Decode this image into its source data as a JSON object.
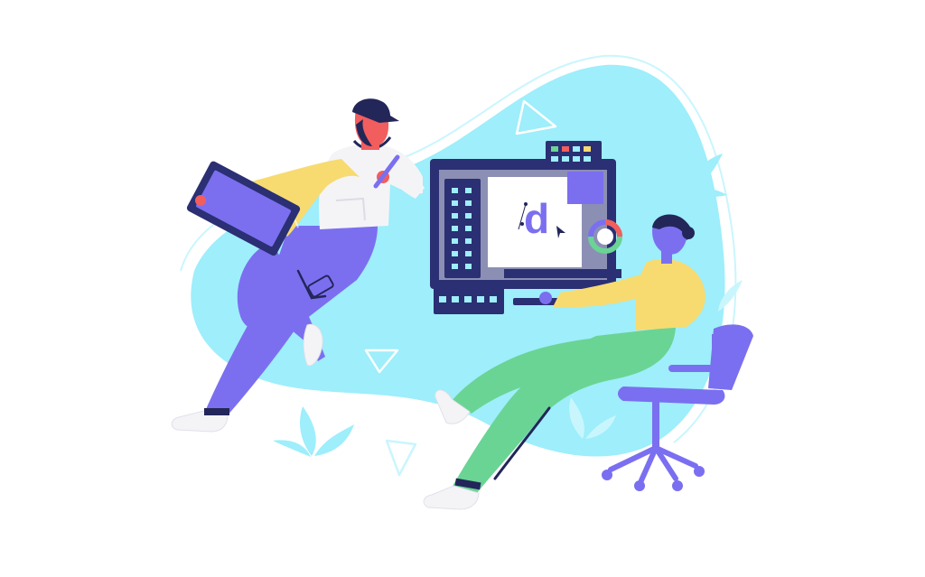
{
  "illustration": {
    "monitor_letter": "d"
  },
  "colors": {
    "background": "#ffffff",
    "blob": "#9eeefb",
    "blob_light": "#c9f6fd",
    "purple": "#7b6ff0",
    "navy": "#232659",
    "monitor_frame": "#2b2f73",
    "screen_gray": "#8c8fb4",
    "yellow": "#f7db71",
    "green": "#6ad494",
    "skin": "#f25d5d",
    "white_shirt": "#f4f4f7",
    "chair": "#7a6ff0"
  },
  "icons": [
    "leaf-decoration-icon",
    "triangle-outline-icon",
    "cursor-arrow-icon",
    "color-wheel-icon",
    "pen-stylus-icon"
  ]
}
